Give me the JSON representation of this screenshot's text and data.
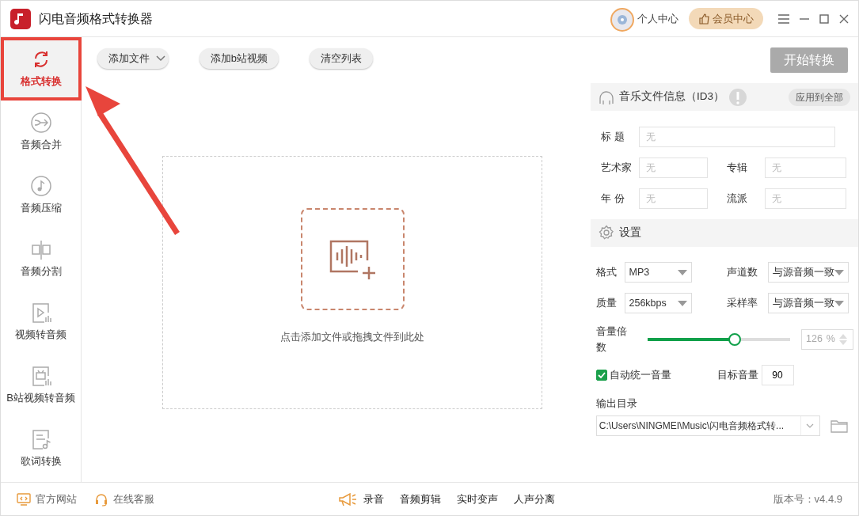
{
  "window": {
    "title": "闪电音频格式转换器",
    "user_center": "个人中心",
    "vip_center": "会员中心"
  },
  "sidebar": {
    "items": [
      {
        "kind": "convert",
        "label": "格式转换",
        "selected": true
      },
      {
        "kind": "merge",
        "label": "音频合并",
        "selected": false
      },
      {
        "kind": "compress",
        "label": "音频压缩",
        "selected": false
      },
      {
        "kind": "split",
        "label": "音频分割",
        "selected": false
      },
      {
        "kind": "video",
        "label": "视频转音频",
        "selected": false
      },
      {
        "kind": "bilibili",
        "label": "B站视频转音频",
        "selected": false
      },
      {
        "kind": "lyrics",
        "label": "歌词转换",
        "selected": false
      }
    ]
  },
  "toolbar": {
    "add_file": "添加文件",
    "add_bilibili": "添加b站视频",
    "clear": "清空列表",
    "start": "开始转换"
  },
  "drop_zone": {
    "hint": "点击添加文件或拖拽文件到此处"
  },
  "id3": {
    "title": "音乐文件信息（ID3）",
    "apply_all": "应用到全部",
    "rows": [
      [
        {
          "label": "标 题",
          "placeholder": "无"
        }
      ],
      [
        {
          "label": "艺术家",
          "placeholder": "无"
        },
        {
          "label": "专辑",
          "placeholder": "无"
        }
      ],
      [
        {
          "label": "年 份",
          "placeholder": "无"
        },
        {
          "label": "流派",
          "placeholder": "无"
        }
      ]
    ]
  },
  "settings": {
    "title": "设置",
    "selects": [
      [
        {
          "label": "格式",
          "value": "MP3"
        },
        {
          "label": "声道数",
          "value": "与源音频一致"
        }
      ],
      [
        {
          "label": "质量",
          "value": "256kbps"
        },
        {
          "label": "采样率",
          "value": "与源音频一致"
        }
      ]
    ],
    "volume": {
      "label": "音量倍数",
      "level": 0.61,
      "value": "126",
      "unit": "%"
    },
    "auto_volume": {
      "label": "自动统一音量",
      "checked": true
    },
    "target_volume": {
      "label": "目标音量",
      "value": "90"
    },
    "output": {
      "label": "输出目录",
      "path": "C:\\Users\\NINGMEI\\Music\\闪电音频格式转..."
    }
  },
  "footer": {
    "links": [
      "官方网站",
      "在线客服"
    ],
    "tools": [
      "录音",
      "音频剪辑",
      "实时变声",
      "人声分离"
    ],
    "version": "版本号：v4.4.9"
  }
}
